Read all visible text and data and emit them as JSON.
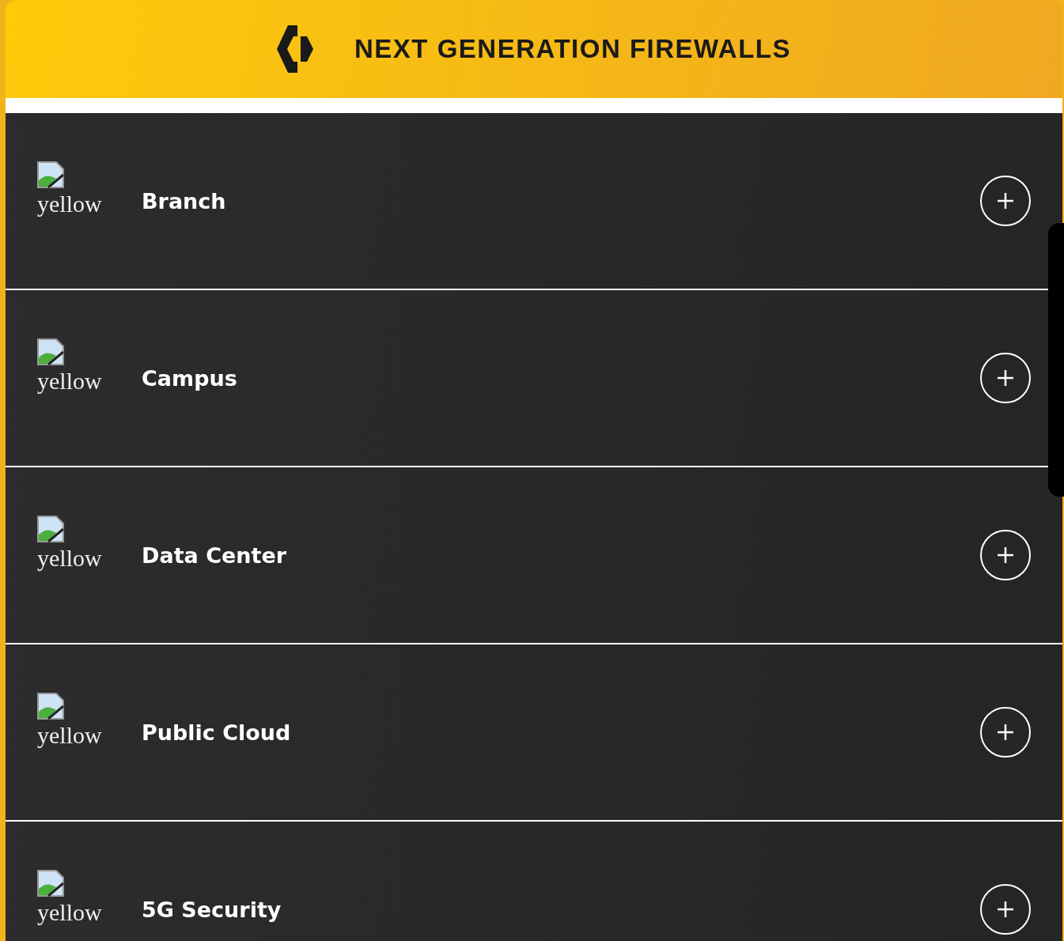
{
  "header": {
    "title": "NEXT GENERATION FIREWALLS"
  },
  "items": [
    {
      "title": "Branch",
      "image_alt": "yellow",
      "expanded": false
    },
    {
      "title": "Campus",
      "image_alt": "yellow",
      "expanded": false
    },
    {
      "title": "Data Center",
      "image_alt": "yellow",
      "expanded": false
    },
    {
      "title": "Public Cloud",
      "image_alt": "yellow",
      "expanded": false
    },
    {
      "title": "5G Security",
      "image_alt": "yellow",
      "expanded": false
    }
  ]
}
